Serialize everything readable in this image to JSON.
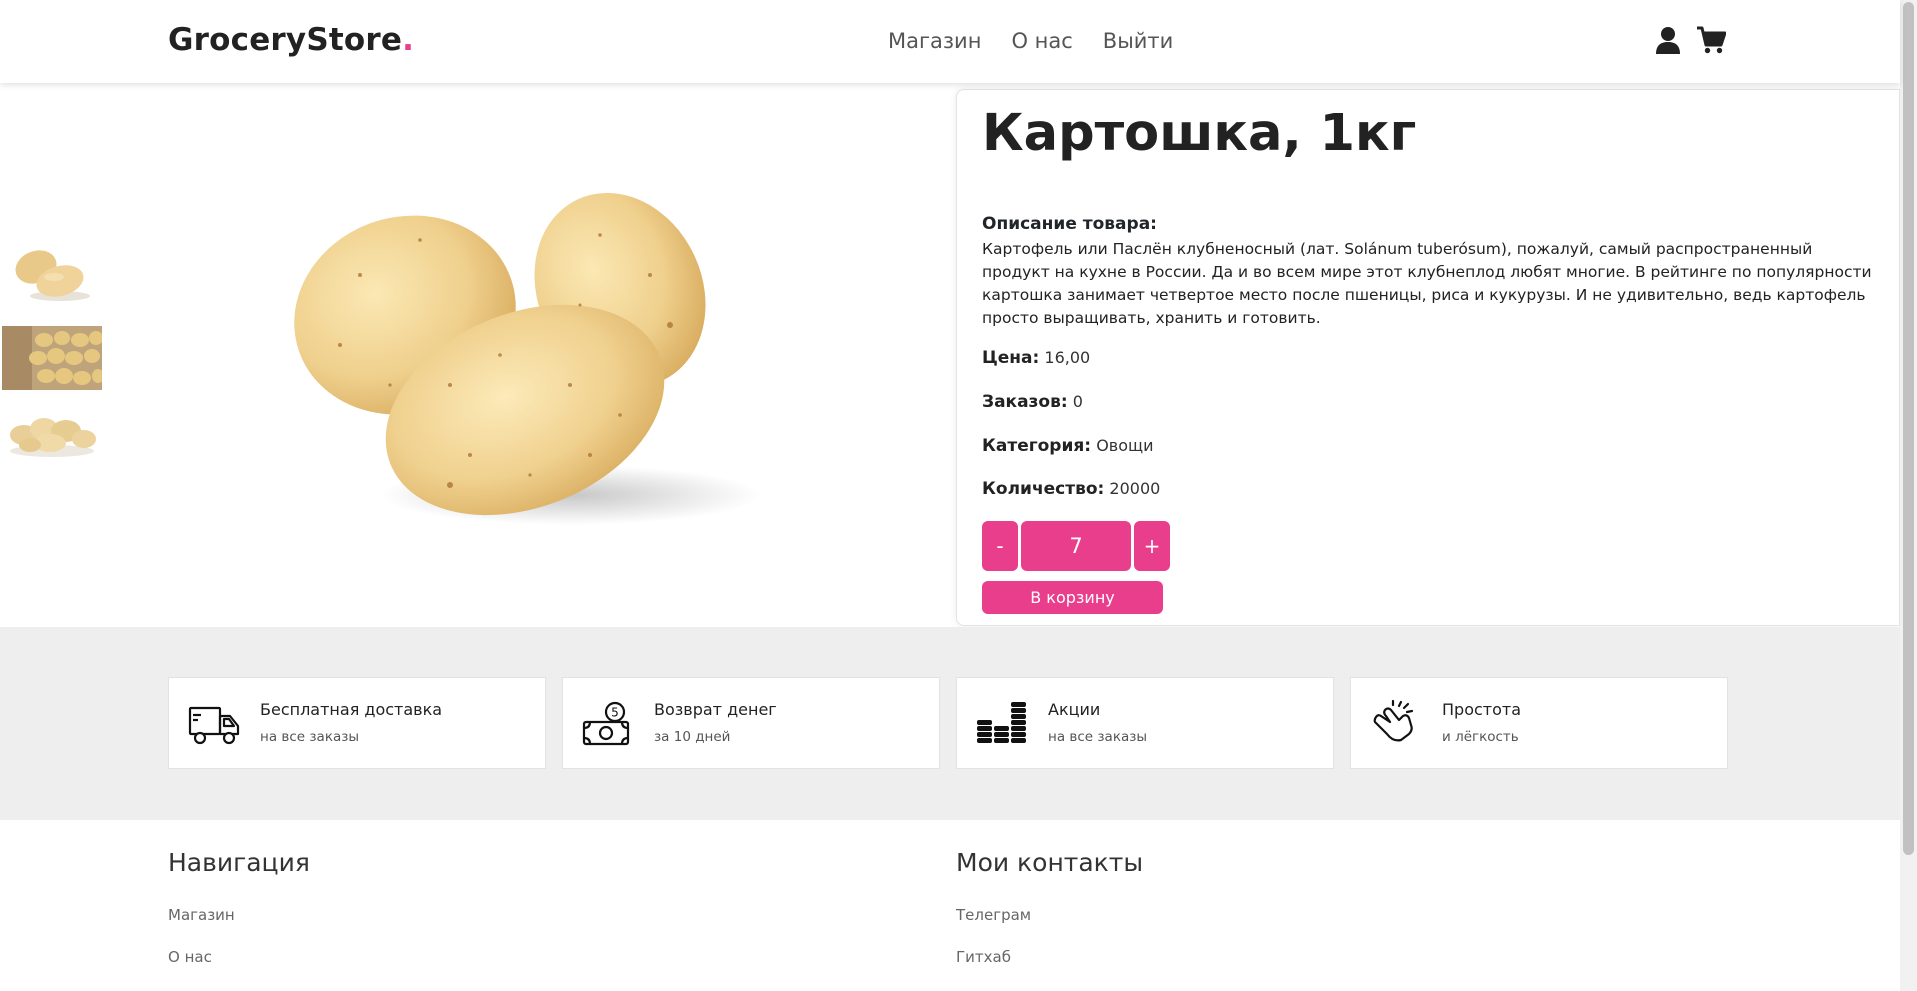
{
  "header": {
    "logo_text": "GroceryStore",
    "logo_dot": ".",
    "nav": [
      "Магазин",
      "О нас",
      "Выйти"
    ],
    "icons": [
      "user-icon",
      "cart-icon"
    ]
  },
  "product": {
    "title": "Картошка, 1кг",
    "description_label": "Описание товара:",
    "description": "Картофель или Паслён клубненосный (лат. Solánum tuberósum), пожалуй, самый распространенный продукт на кухне в России. Да и во всем мире этот клубнеплод любят многие. В рейтинге по популярности картошка занимает четвертое место после пшеницы, риса и кукурузы. И не удивительно, ведь картофель просто выращивать, хранить и готовить.",
    "price_label": "Цена:",
    "price": "16,00",
    "orders_label": "Заказов:",
    "orders": "0",
    "category_label": "Категория:",
    "category": "Овощи",
    "quantity_label": "Количество:",
    "quantity": "20000",
    "minus_label": "-",
    "plus_label": "+",
    "selected_qty": "7",
    "add_to_cart_label": "В корзину"
  },
  "features": [
    {
      "title": "Бесплатная доставка",
      "subtitle": "на все заказы",
      "icon": "delivery-truck-icon"
    },
    {
      "title": "Возврат денег",
      "subtitle": "за 10 дней",
      "icon": "money-return-icon"
    },
    {
      "title": "Акции",
      "subtitle": "на все заказы",
      "icon": "coins-stack-icon"
    },
    {
      "title": "Простота",
      "subtitle": "и лёгкость",
      "icon": "finger-snap-icon"
    }
  ],
  "footer": {
    "nav_title": "Навигация",
    "nav_links": [
      "Магазин",
      "О нас"
    ],
    "contacts_title": "Мои контакты",
    "contact_links": [
      "Телеграм",
      "Гитхаб"
    ]
  },
  "colors": {
    "accent": "#e83e8c",
    "features_bg": "#eeeeee"
  }
}
